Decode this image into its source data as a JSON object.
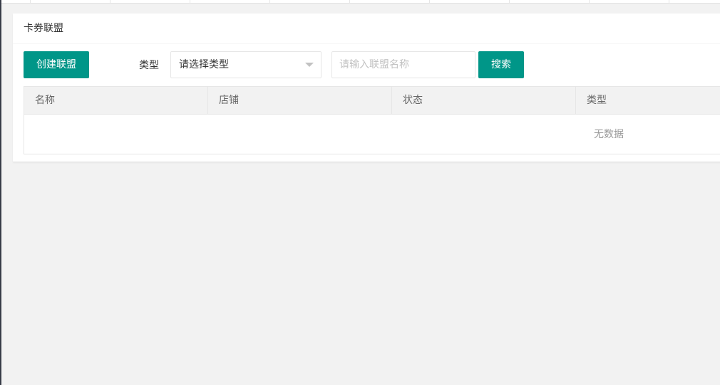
{
  "page": {
    "title": "卡券联盟"
  },
  "toolbar": {
    "create_label": "创建联盟",
    "type_label": "类型",
    "type_select_value": "请选择类型",
    "name_placeholder": "请输入联盟名称",
    "search_label": "搜索"
  },
  "table": {
    "columns": [
      "名称",
      "店铺",
      "状态",
      "类型"
    ],
    "rows": [],
    "empty_text": "无数据"
  },
  "colors": {
    "primary": "#009688",
    "background": "#f2f2f2",
    "border": "#e6e6e6"
  },
  "icons": {
    "select_arrow": "caret-down-icon"
  }
}
